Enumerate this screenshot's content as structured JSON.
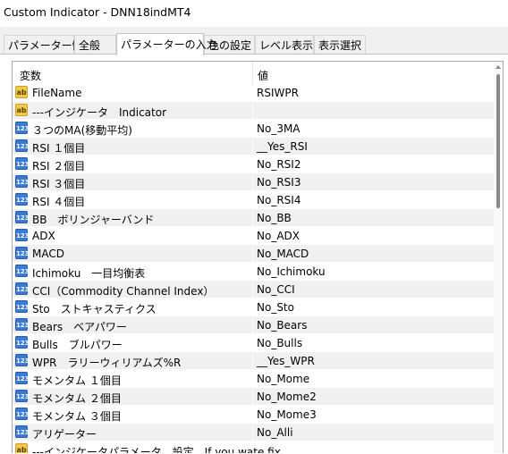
{
  "window": {
    "title": "Custom Indicator - DNN18indMT4"
  },
  "tabs": [
    {
      "label": "パラメーター情報"
    },
    {
      "label": "全般"
    },
    {
      "label": "パラメーターの入力"
    },
    {
      "label": "色の設定"
    },
    {
      "label": "レベル表示"
    },
    {
      "label": "表示選択"
    }
  ],
  "grid": {
    "columns": {
      "variable": "変数",
      "value": "値"
    },
    "rows": [
      {
        "type": "string",
        "icon": "ab",
        "name": "FileName",
        "value": "RSIWPR"
      },
      {
        "type": "string",
        "icon": "ab",
        "name": "---インジケータ　Indicator",
        "value": ""
      },
      {
        "type": "int",
        "icon": "123",
        "name": "３つのMA(移動平均)",
        "value": "No_3MA"
      },
      {
        "type": "int",
        "icon": "123",
        "name": "RSI １個目",
        "value": "__Yes_RSI"
      },
      {
        "type": "int",
        "icon": "123",
        "name": "RSI ２個目",
        "value": "No_RSI2"
      },
      {
        "type": "int",
        "icon": "123",
        "name": "RSI ３個目",
        "value": "No_RSI3"
      },
      {
        "type": "int",
        "icon": "123",
        "name": "RSI ４個目",
        "value": "No_RSI4"
      },
      {
        "type": "int",
        "icon": "123",
        "name": "BB　ボリンジャーバンド",
        "value": "No_BB"
      },
      {
        "type": "int",
        "icon": "123",
        "name": "ADX",
        "value": "No_ADX"
      },
      {
        "type": "int",
        "icon": "123",
        "name": "MACD",
        "value": "No_MACD"
      },
      {
        "type": "int",
        "icon": "123",
        "name": "Ichimoku　一目均衡表",
        "value": "No_Ichimoku"
      },
      {
        "type": "int",
        "icon": "123",
        "name": "CCI（Commodity Channel Index）",
        "value": "No_CCI"
      },
      {
        "type": "int",
        "icon": "123",
        "name": "Sto　ストキャスティクス",
        "value": "No_Sto"
      },
      {
        "type": "int",
        "icon": "123",
        "name": "Bears　ベアパワー",
        "value": "No_Bears"
      },
      {
        "type": "int",
        "icon": "123",
        "name": "Bulls　ブルパワー",
        "value": "No_Bulls"
      },
      {
        "type": "int",
        "icon": "123",
        "name": "WPR　ラリーウィリアムズ%R",
        "value": "__Yes_WPR"
      },
      {
        "type": "int",
        "icon": "123",
        "name": "モメンタム １個目",
        "value": "No_Mome"
      },
      {
        "type": "int",
        "icon": "123",
        "name": "モメンタム ２個目",
        "value": "No_Mome2"
      },
      {
        "type": "int",
        "icon": "123",
        "name": "モメンタム ３個目",
        "value": "No_Mome3"
      },
      {
        "type": "int",
        "icon": "123",
        "name": "アリゲーター",
        "value": "No_Alli"
      },
      {
        "type": "string",
        "icon": "ab",
        "name": "---インジケータパラメータ　設定　If you wate fix",
        "value": ""
      }
    ]
  }
}
